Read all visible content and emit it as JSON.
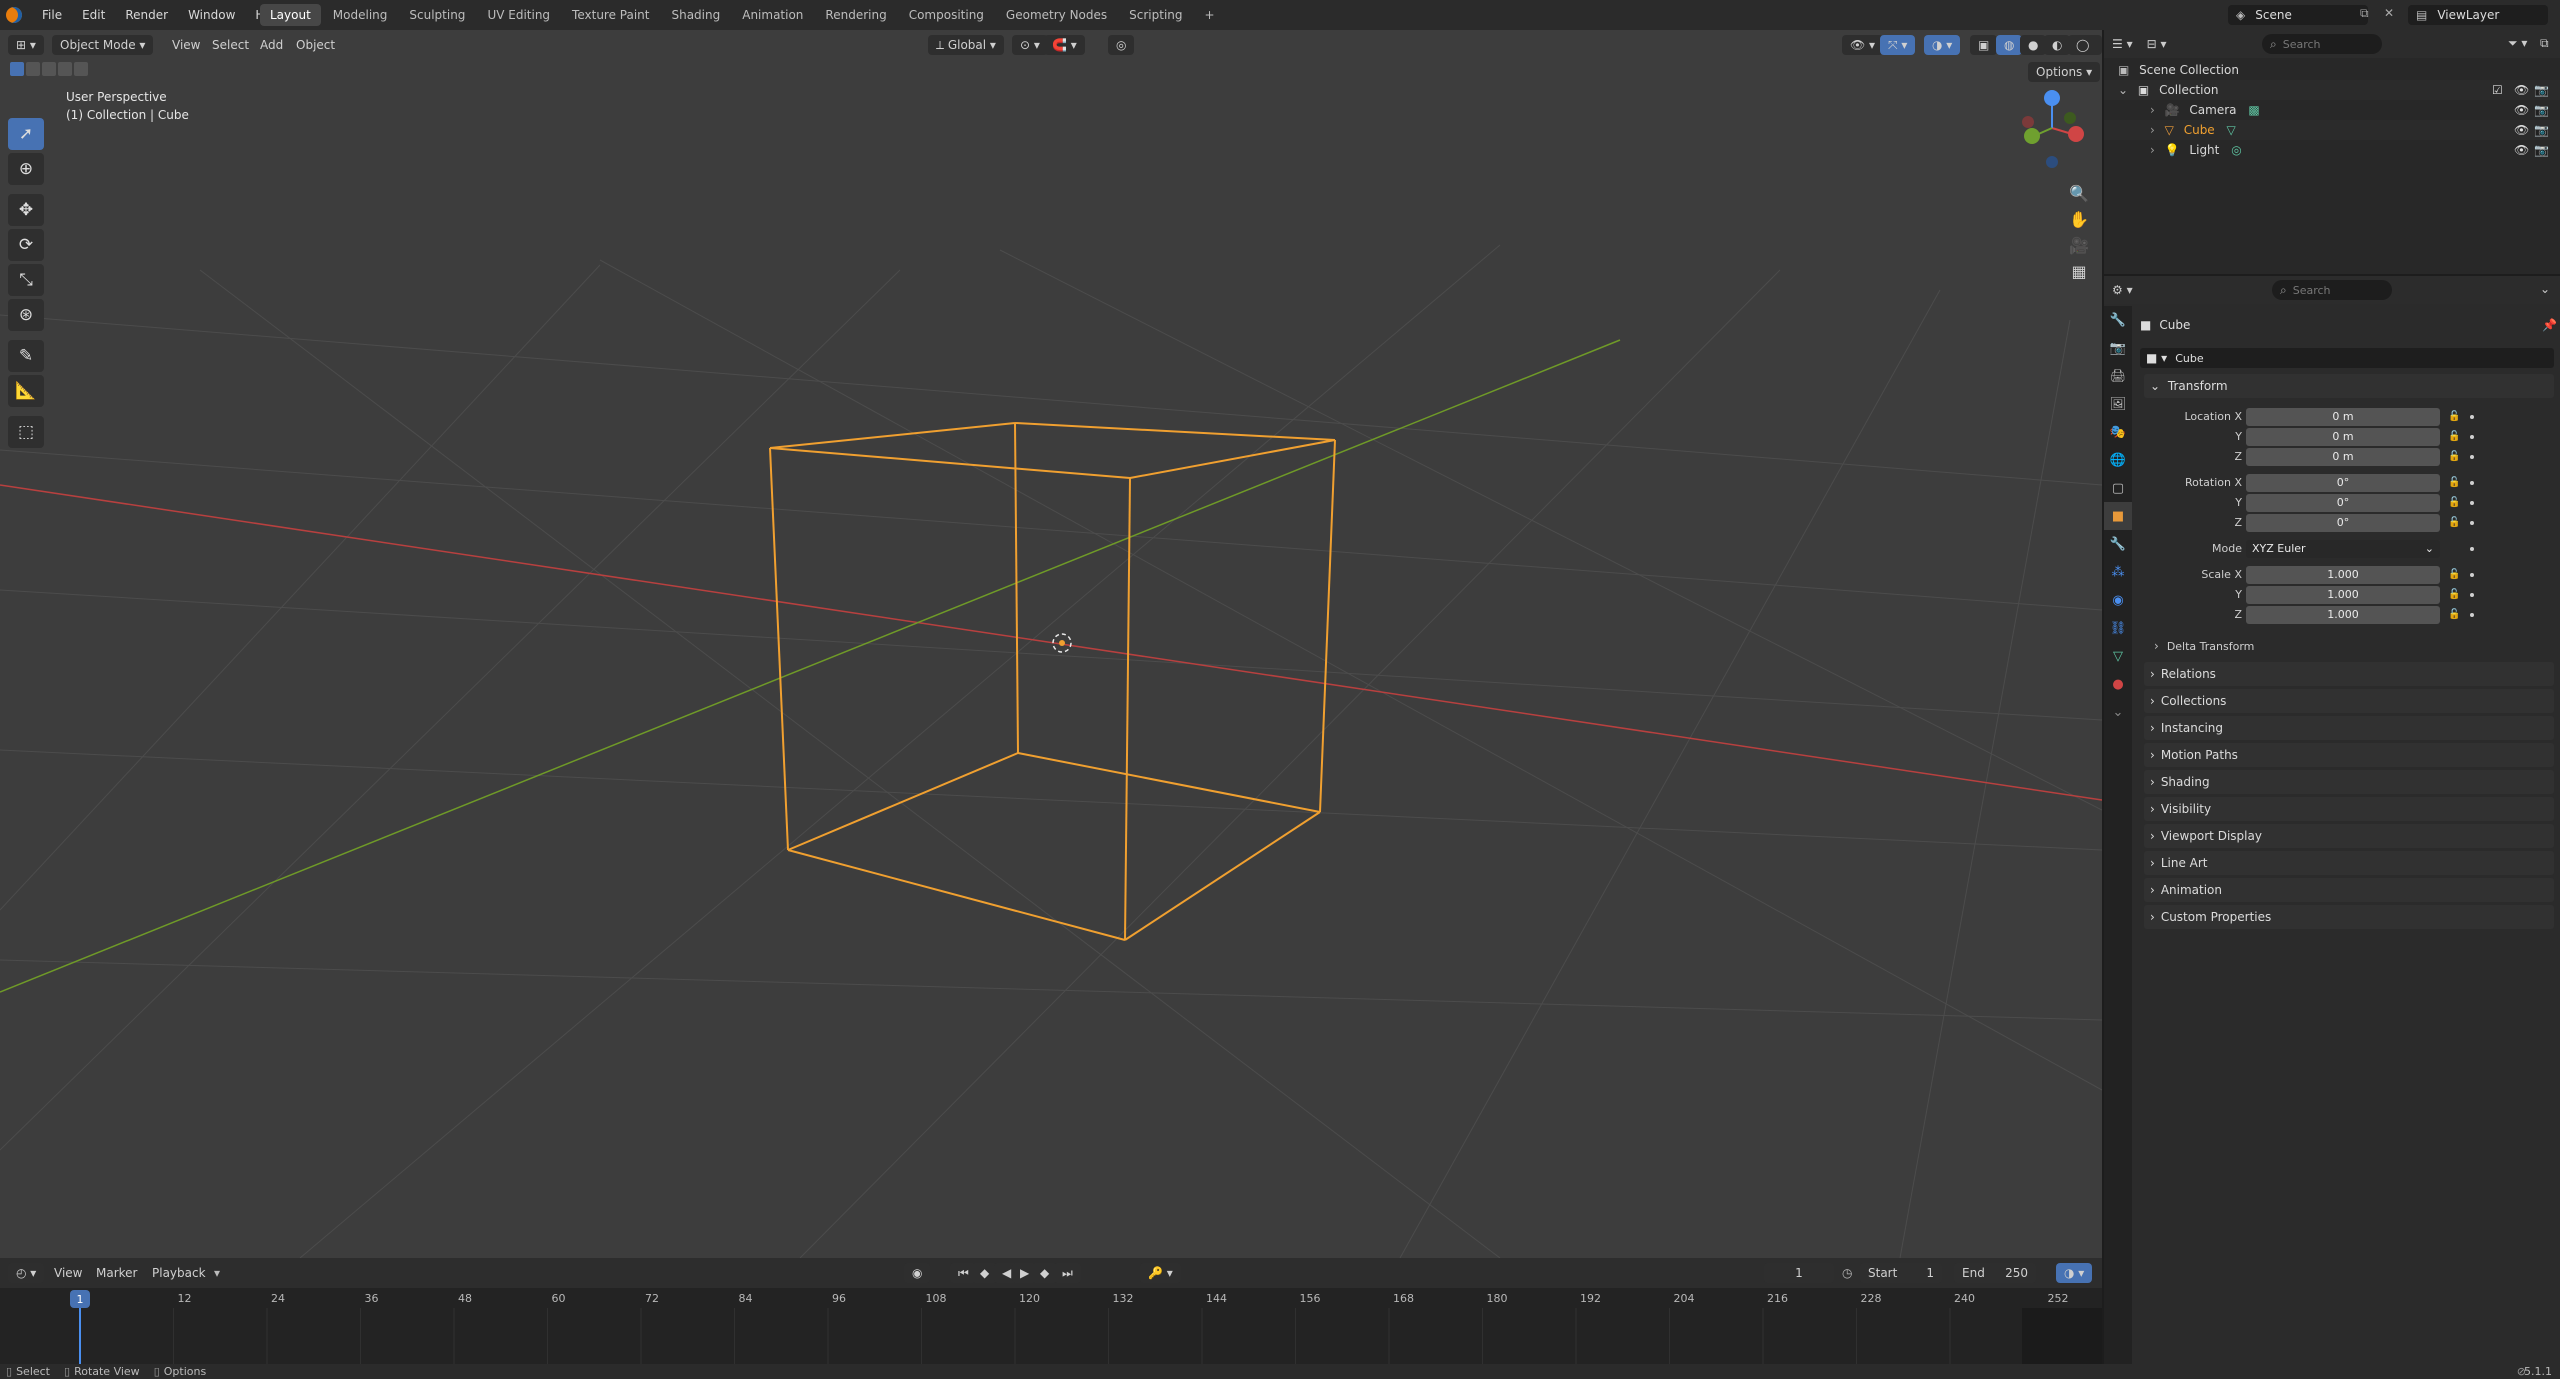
{
  "topbar": {
    "menus": [
      "File",
      "Edit",
      "Render",
      "Window",
      "Help"
    ],
    "workspaces": [
      "Layout",
      "Modeling",
      "Sculpting",
      "UV Editing",
      "Texture Paint",
      "Shading",
      "Animation",
      "Rendering",
      "Compositing",
      "Geometry Nodes",
      "Scripting",
      "+"
    ],
    "active_workspace": "Layout",
    "scene": "Scene",
    "view_layer": "ViewLayer"
  },
  "viewport": {
    "mode": "Object Mode",
    "menus": [
      "View",
      "Select",
      "Add",
      "Object"
    ],
    "transform_orientation": "Global",
    "options_label": "Options",
    "info_line1": "User Perspective",
    "info_line2": "(1) Collection | Cube",
    "colors": {
      "bg": "#3d3d3d",
      "grid": "#4c4c4c",
      "x_axis": "#b8403f",
      "y_axis": "#6f9a28",
      "selection": "#f0a030"
    }
  },
  "timeline": {
    "menus": [
      "View",
      "Marker",
      "Playback"
    ],
    "current_frame": "1",
    "start_label": "Start",
    "start": "1",
    "end_label": "End",
    "end": "250",
    "ticks": [
      "1",
      "12",
      "24",
      "36",
      "48",
      "60",
      "72",
      "84",
      "96",
      "108",
      "120",
      "132",
      "144",
      "156",
      "168",
      "180",
      "192",
      "204",
      "216",
      "228",
      "240",
      "252"
    ]
  },
  "statusbar": {
    "select": "Select",
    "rotate": "Rotate View",
    "options": "Options",
    "version": "5.1.1"
  },
  "outliner": {
    "search_placeholder": "Search",
    "root": "Scene Collection",
    "collection": "Collection",
    "items": [
      "Camera",
      "Cube",
      "Light"
    ]
  },
  "properties": {
    "search_placeholder": "Search",
    "object_name": "Cube",
    "datablock_name": "Cube",
    "transform": {
      "title": "Transform",
      "location_label": "Location X",
      "rotation_label": "Rotation X",
      "scale_label": "Scale X",
      "y_label": "Y",
      "z_label": "Z",
      "location": [
        "0 m",
        "0 m",
        "0 m"
      ],
      "rotation": [
        "0°",
        "0°",
        "0°"
      ],
      "mode_label": "Mode",
      "mode": "XYZ Euler",
      "scale": [
        "1.000",
        "1.000",
        "1.000"
      ],
      "delta": "Delta Transform"
    },
    "panels": [
      "Relations",
      "Collections",
      "Instancing",
      "Motion Paths",
      "Shading",
      "Visibility",
      "Viewport Display",
      "Line Art",
      "Animation",
      "Custom Properties"
    ]
  }
}
